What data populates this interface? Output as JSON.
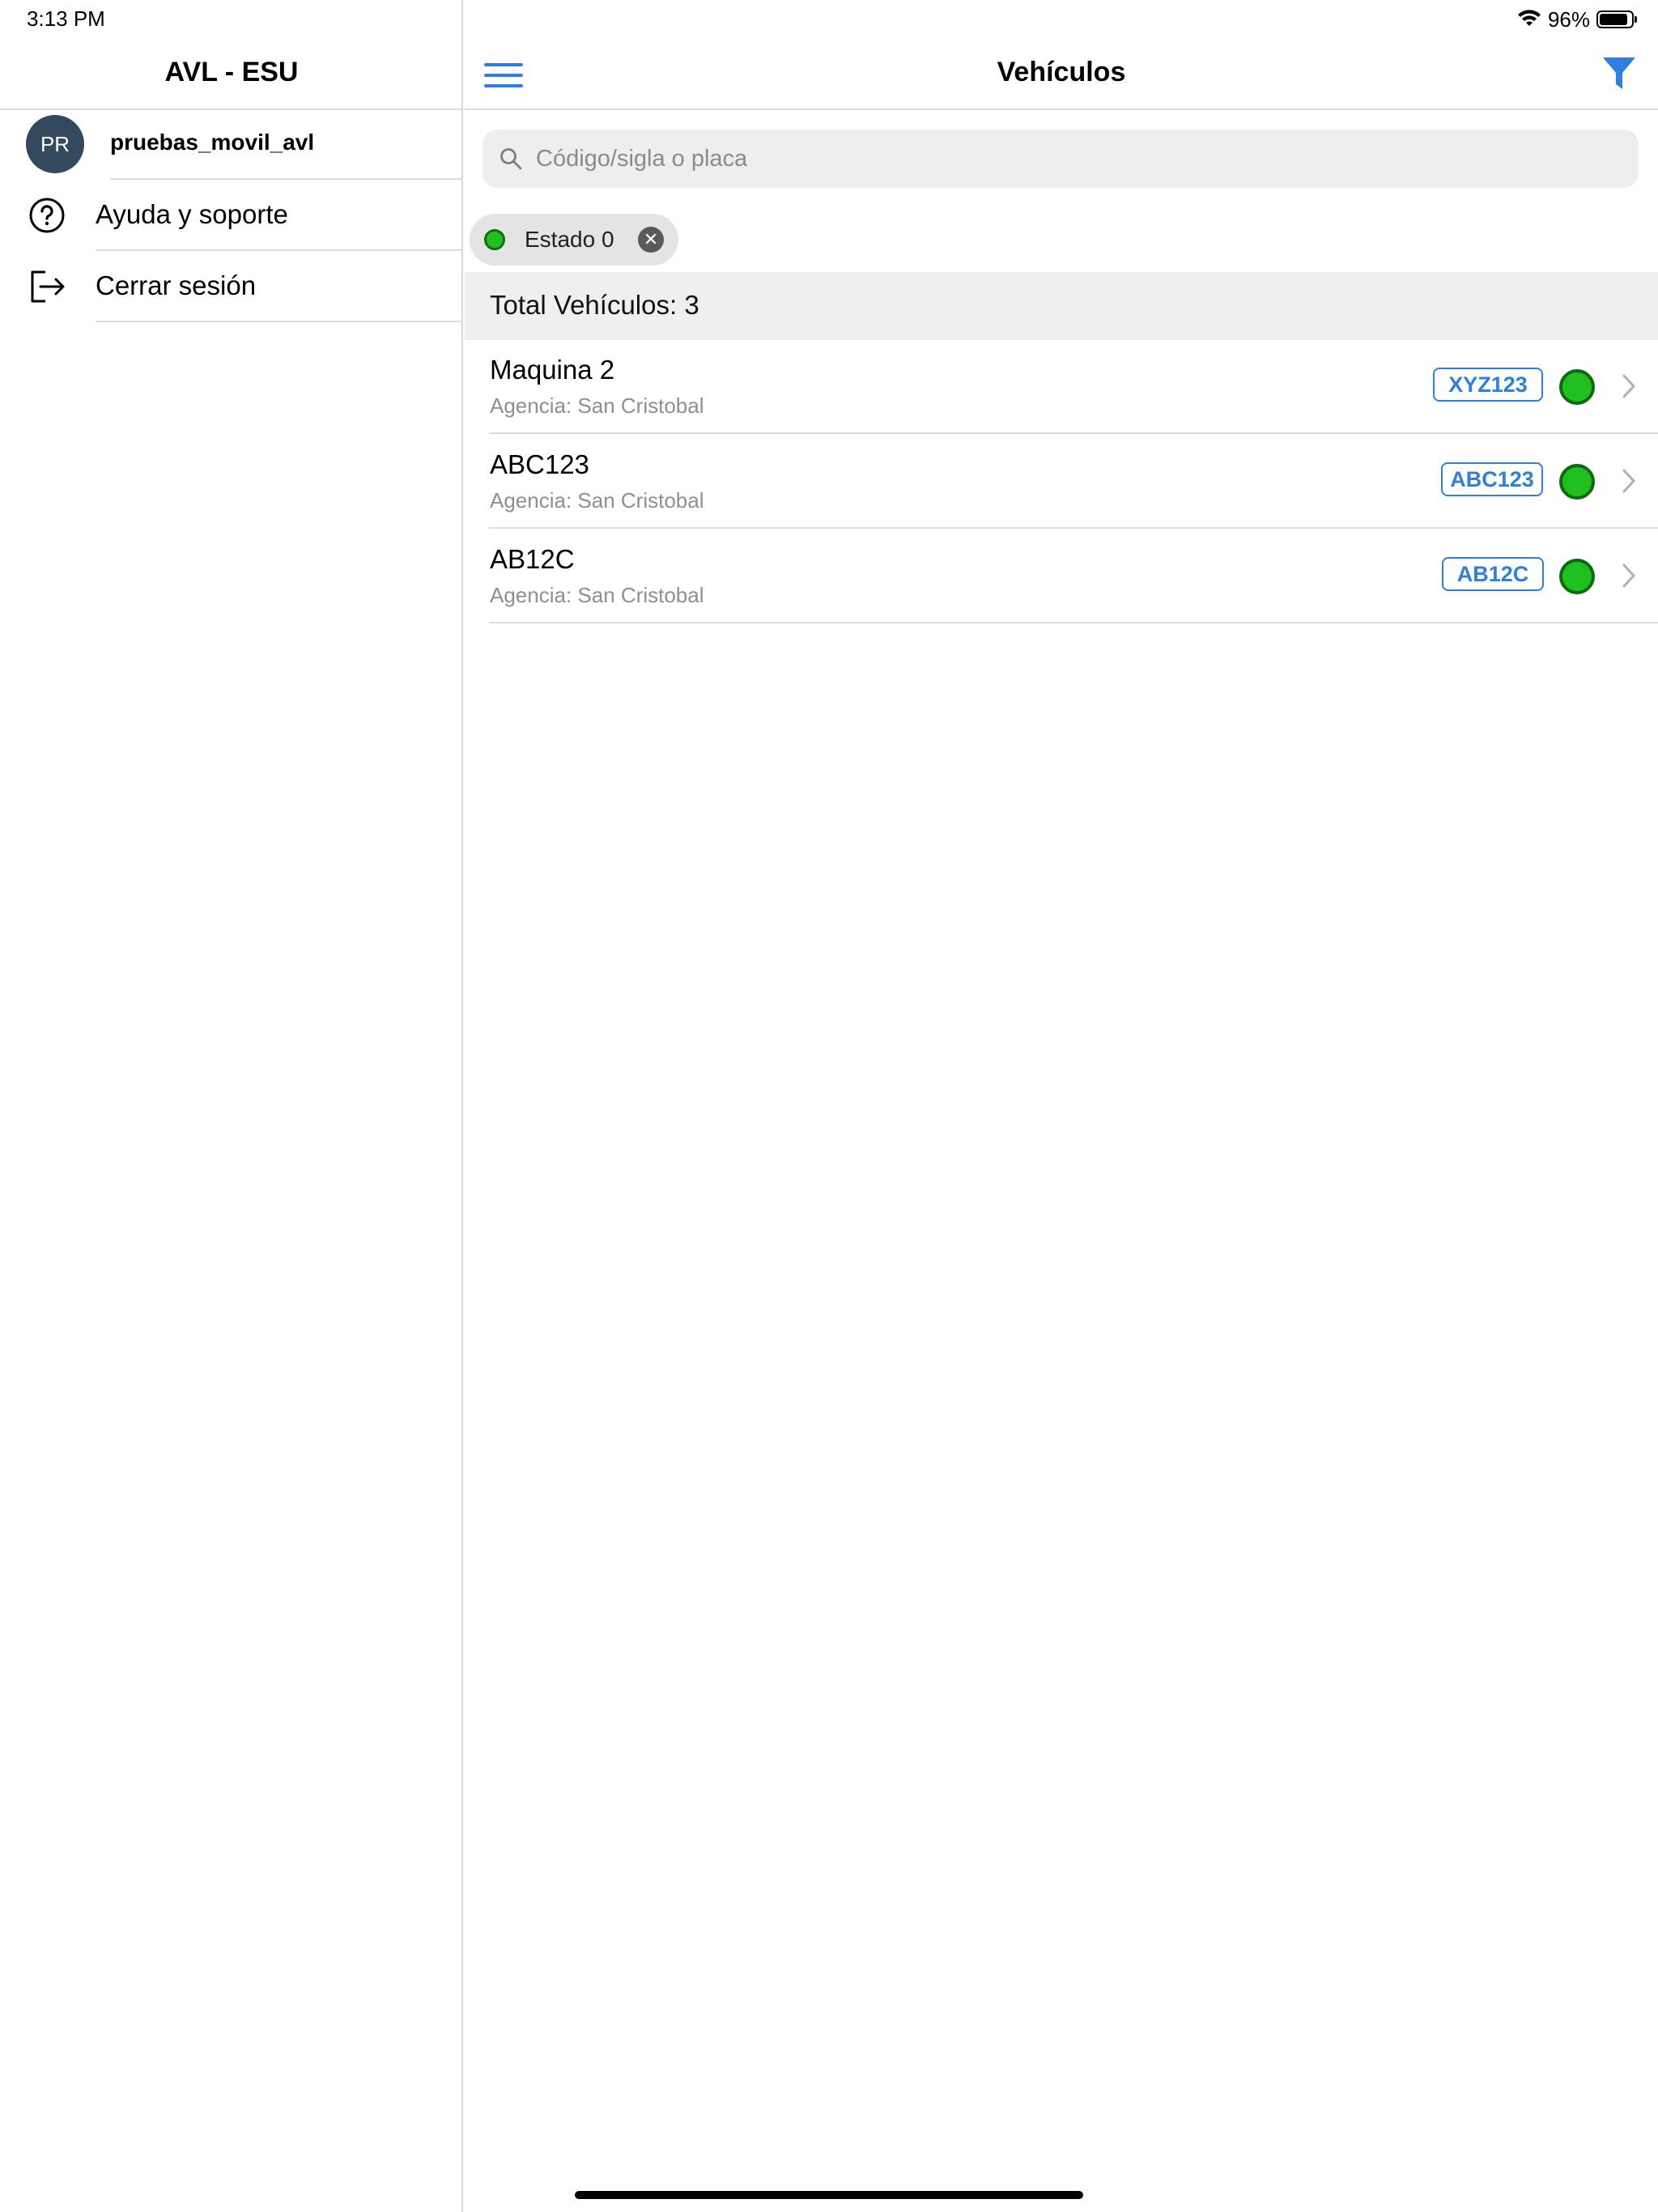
{
  "status_bar": {
    "time": "3:13 PM",
    "battery_percent": "96%",
    "battery_level": 0.96
  },
  "sidebar": {
    "title": "AVL - ESU",
    "profile": {
      "initials": "PR",
      "username": "pruebas_movil_avl"
    },
    "items": [
      {
        "label": "Ayuda y soporte",
        "icon": "question-circle-icon"
      },
      {
        "label": "Cerrar sesión",
        "icon": "logout-icon"
      }
    ]
  },
  "main": {
    "title": "Vehículos",
    "search": {
      "placeholder": "Código/sigla o placa",
      "value": ""
    },
    "filter_chip": {
      "label": "Estado 0",
      "status_color": "#1fc01f"
    },
    "total_label": "Total Vehículos: 3",
    "vehicles": [
      {
        "name": "Maquina 2",
        "agency": "Agencia: San Cristobal",
        "plate": "XYZ123",
        "status_color": "#1fbf1f"
      },
      {
        "name": "ABC123",
        "agency": "Agencia: San Cristobal",
        "plate": "ABC123",
        "status_color": "#1fbf1f"
      },
      {
        "name": "AB12C",
        "agency": "Agencia: San Cristobal",
        "plate": "AB12C",
        "status_color": "#1fbf1f"
      }
    ]
  },
  "colors": {
    "accent": "#2f7fe0",
    "status_green": "#1fbf1f",
    "avatar_bg": "#34495e"
  }
}
